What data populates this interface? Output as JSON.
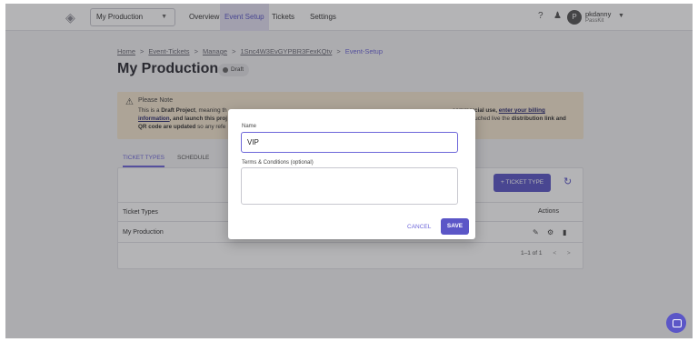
{
  "nav": {
    "project_select": "My Production",
    "links": [
      "Overview",
      "Event Setup",
      "Tickets",
      "Settings"
    ],
    "user_initial": "P",
    "user_name": "pkdanny",
    "user_org": "PassKit"
  },
  "breadcrumb": [
    "Home",
    "Event-Tickets",
    "Manage",
    "1Snc4W3EvGYPBR3FexKQtv",
    "Event-Setup"
  ],
  "page": {
    "title": "My Production",
    "badge": "Draft"
  },
  "note": {
    "title": "Please Note",
    "t1": "This is a ",
    "t2": "Draft Project",
    "t3": ", meaning th",
    "t4": "commercial use, ",
    "t5": "enter your billing",
    "t6": "information",
    "t7": ", and launch this proj",
    "t8": "e lauched live the ",
    "t9": "distribution link and",
    "t10": "QR code are updated",
    "t11": " so any refe"
  },
  "tabs": [
    "TICKET TYPES",
    "SCHEDULE"
  ],
  "table": {
    "add_button": "+ TICKET TYPE",
    "col_name": "Ticket Types",
    "col_actions": "Actions",
    "rows": [
      "My Production"
    ],
    "pager": "1–1 of 1"
  },
  "modal": {
    "name_label": "Name",
    "name_value": "VIP",
    "terms_label": "Terms & Conditions (optional)",
    "terms_value": "",
    "cancel": "CANCEL",
    "save": "SAVE"
  },
  "colors": {
    "accent": "#5b56c7",
    "note_bg": "#f5e7cf"
  }
}
